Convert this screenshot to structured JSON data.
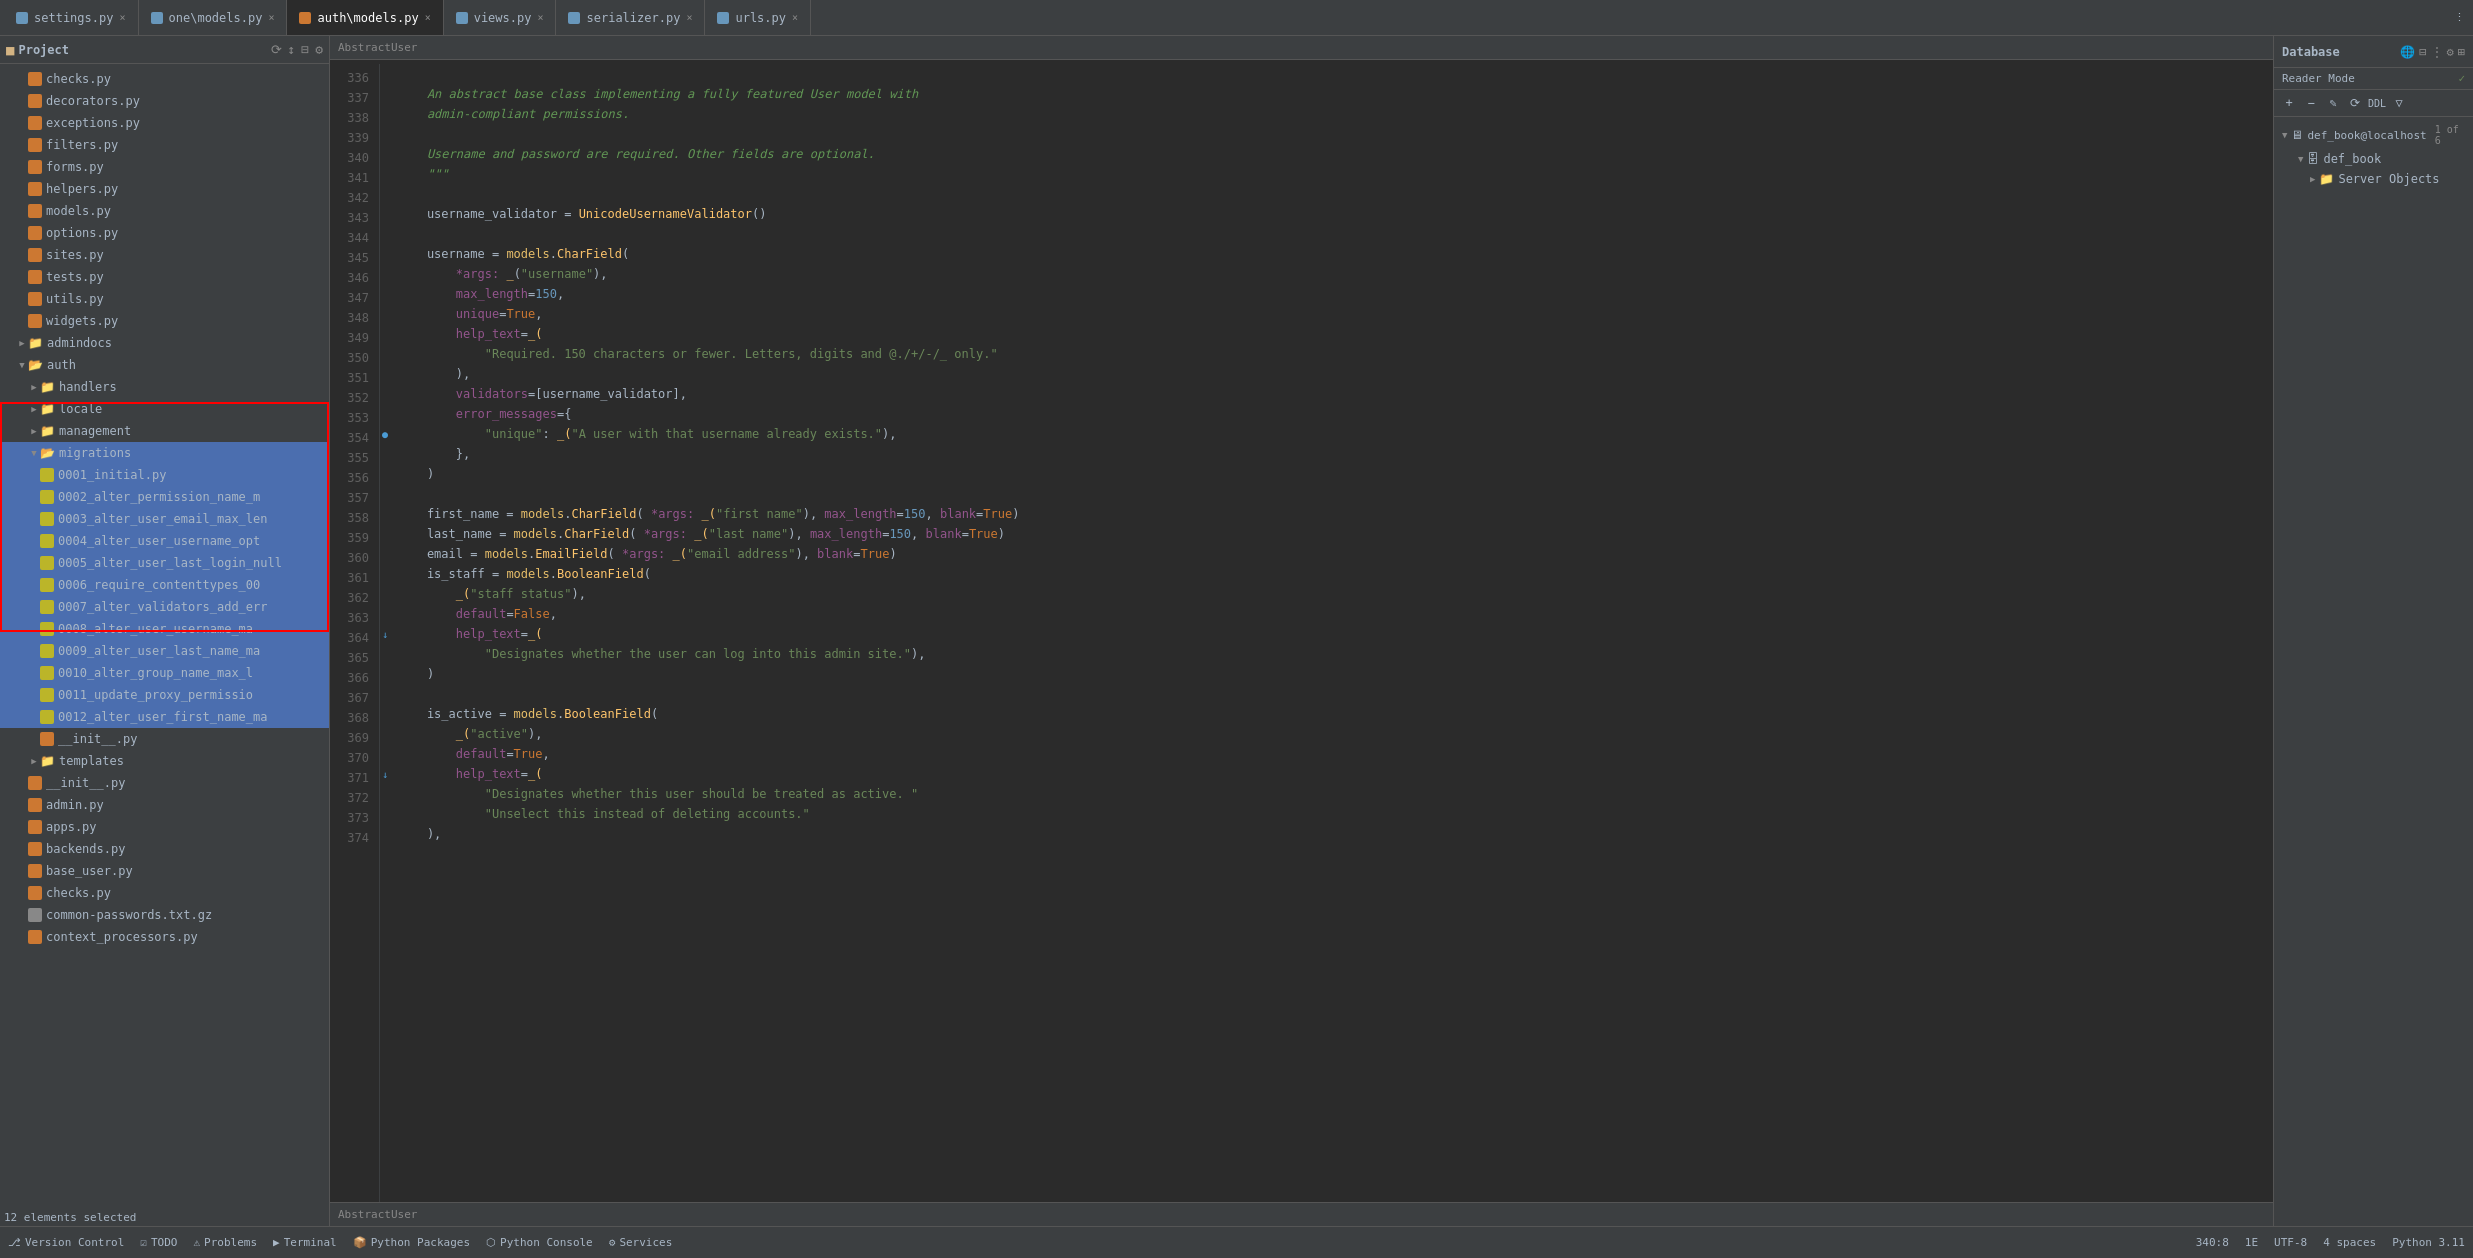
{
  "tabs": [
    {
      "label": "settings.py",
      "active": false,
      "type": "python"
    },
    {
      "label": "one\\models.py",
      "active": false,
      "type": "python"
    },
    {
      "label": "auth\\models.py",
      "active": true,
      "type": "python"
    },
    {
      "label": "views.py",
      "active": false,
      "type": "python"
    },
    {
      "label": "serializer.py",
      "active": false,
      "type": "python"
    },
    {
      "label": "urls.py",
      "active": false,
      "type": "python"
    }
  ],
  "breadcrumb": "AbstractUser",
  "database": {
    "title": "Database",
    "server": "def_book@localhost",
    "page_info": "1 of 6",
    "db_name": "def_book",
    "server_objects": "Server Objects"
  },
  "reader_mode": "Reader Mode",
  "sidebar": {
    "project_title": "Project",
    "files": [
      {
        "name": "checks.py",
        "type": "python",
        "indent": 1
      },
      {
        "name": "decorators.py",
        "type": "python",
        "indent": 1
      },
      {
        "name": "exceptions.py",
        "type": "python",
        "indent": 1
      },
      {
        "name": "filters.py",
        "type": "python",
        "indent": 1
      },
      {
        "name": "forms.py",
        "type": "python",
        "indent": 1
      },
      {
        "name": "helpers.py",
        "type": "python",
        "indent": 1
      },
      {
        "name": "models.py",
        "type": "python",
        "indent": 1
      },
      {
        "name": "options.py",
        "type": "python",
        "indent": 1
      },
      {
        "name": "sites.py",
        "type": "python",
        "indent": 1
      },
      {
        "name": "tests.py",
        "type": "python",
        "indent": 1
      },
      {
        "name": "utils.py",
        "type": "python",
        "indent": 1
      },
      {
        "name": "widgets.py",
        "type": "python",
        "indent": 1
      },
      {
        "name": "admindocs",
        "type": "folder",
        "indent": 1,
        "collapsed": true
      },
      {
        "name": "auth",
        "type": "folder",
        "indent": 1,
        "collapsed": false
      },
      {
        "name": "handlers",
        "type": "folder",
        "indent": 2,
        "collapsed": true
      },
      {
        "name": "locale",
        "type": "folder",
        "indent": 2,
        "collapsed": true
      },
      {
        "name": "management",
        "type": "folder",
        "indent": 2,
        "collapsed": true
      },
      {
        "name": "migrations",
        "type": "folder",
        "indent": 2,
        "collapsed": false,
        "selected": true
      },
      {
        "name": "0001_initial.py",
        "type": "migration",
        "indent": 3,
        "selected": true
      },
      {
        "name": "0002_alter_permission_name_m",
        "type": "migration",
        "indent": 3,
        "selected": true
      },
      {
        "name": "0003_alter_user_email_max_len",
        "type": "migration",
        "indent": 3,
        "selected": true
      },
      {
        "name": "0004_alter_user_username_opt",
        "type": "migration",
        "indent": 3,
        "selected": true
      },
      {
        "name": "0005_alter_user_last_login_null",
        "type": "migration",
        "indent": 3,
        "selected": true
      },
      {
        "name": "0006_require_contenttypes_00",
        "type": "migration",
        "indent": 3,
        "selected": true
      },
      {
        "name": "0007_alter_validators_add_err",
        "type": "migration",
        "indent": 3,
        "selected": true
      },
      {
        "name": "0008_alter_user_username_ma",
        "type": "migration",
        "indent": 3,
        "selected": true
      },
      {
        "name": "0009_alter_user_last_name_ma",
        "type": "migration",
        "indent": 3,
        "selected": true
      },
      {
        "name": "0010_alter_group_name_max_l",
        "type": "migration",
        "indent": 3,
        "selected": true
      },
      {
        "name": "0011_update_proxy_permissio",
        "type": "migration",
        "indent": 3,
        "selected": true
      },
      {
        "name": "0012_alter_user_first_name_ma",
        "type": "migration",
        "indent": 3,
        "selected": true
      },
      {
        "name": "__init__.py",
        "type": "python",
        "indent": 3
      },
      {
        "name": "templates",
        "type": "folder",
        "indent": 2,
        "collapsed": true
      },
      {
        "name": "__init__.py",
        "type": "python",
        "indent": 2
      },
      {
        "name": "admin.py",
        "type": "python",
        "indent": 2
      },
      {
        "name": "apps.py",
        "type": "python",
        "indent": 2
      },
      {
        "name": "backends.py",
        "type": "python",
        "indent": 2
      },
      {
        "name": "base_user.py",
        "type": "python",
        "indent": 2
      },
      {
        "name": "checks.py",
        "type": "python",
        "indent": 2
      },
      {
        "name": "common-passwords.txt.gz",
        "type": "text",
        "indent": 2
      },
      {
        "name": "context_processors.py",
        "type": "python",
        "indent": 2
      }
    ]
  },
  "code_lines": [
    {
      "num": 336,
      "content": ""
    },
    {
      "num": 337,
      "content": "    An abstract base class implementing a fully featured User model with"
    },
    {
      "num": 338,
      "content": "    admin-compliant permissions."
    },
    {
      "num": 339,
      "content": ""
    },
    {
      "num": 340,
      "content": "    Username and password are required. Other fields are optional."
    },
    {
      "num": 341,
      "content": "    \"\"\""
    },
    {
      "num": 342,
      "content": ""
    },
    {
      "num": 343,
      "content": "    username_validator = UnicodeUsernameValidator()"
    },
    {
      "num": 344,
      "content": ""
    },
    {
      "num": 345,
      "content": "    username = models.CharField("
    },
    {
      "num": 346,
      "content": "        *args: _(\"username\"),"
    },
    {
      "num": 347,
      "content": "        max_length=150,"
    },
    {
      "num": 348,
      "content": "        unique=True,"
    },
    {
      "num": 349,
      "content": "        help_text=_("
    },
    {
      "num": 350,
      "content": "            \"Required. 150 characters or fewer. Letters, digits and @./+/-/_ only.\""
    },
    {
      "num": 351,
      "content": "        ),"
    },
    {
      "num": 352,
      "content": "        validators=[username_validator],"
    },
    {
      "num": 353,
      "content": "        error_messages={"
    },
    {
      "num": 354,
      "content": "            \"unique\": _(\"A user with that username already exists.\"),"
    },
    {
      "num": 355,
      "content": "        },"
    },
    {
      "num": 356,
      "content": "    )"
    },
    {
      "num": 357,
      "content": ""
    },
    {
      "num": 358,
      "content": "    first_name = models.CharField( *args: _(\"first name\"), max_length=150, blank=True)"
    },
    {
      "num": 359,
      "content": "    last_name = models.CharField( *args: _(\"last name\"), max_length=150, blank=True)"
    },
    {
      "num": 360,
      "content": "    email = models.EmailField( *args: _(\"email address\"), blank=True)"
    },
    {
      "num": 361,
      "content": "    is_staff = models.BooleanField("
    },
    {
      "num": 362,
      "content": "        _(\"staff status\"),"
    },
    {
      "num": 363,
      "content": "        default=False,"
    },
    {
      "num": 364,
      "content": "        help_text=_("
    },
    {
      "num": 365,
      "content": "            \"Designates whether the user can log into this admin site.\"),"
    },
    {
      "num": 366,
      "content": "    )"
    },
    {
      "num": 367,
      "content": ""
    },
    {
      "num": 368,
      "content": "    is_active = models.BooleanField("
    },
    {
      "num": 369,
      "content": "        _(\"active\"),"
    },
    {
      "num": 370,
      "content": "        default=True,"
    },
    {
      "num": 371,
      "content": "        help_text=_("
    },
    {
      "num": 372,
      "content": "            \"Designates whether this user should be treated as active. \""
    },
    {
      "num": 373,
      "content": "            \"Unselect this instead of deleting accounts.\""
    },
    {
      "num": 374,
      "content": "    ),"
    }
  ],
  "status_bar": {
    "version_control": "Version Control",
    "todo": "TODO",
    "problems": "Problems",
    "terminal": "Terminal",
    "python_packages": "Python Packages",
    "python_console": "Python Console",
    "services": "Services"
  },
  "info_bar": {
    "position": "340:8",
    "line": "1E",
    "encoding": "UTF-8",
    "indent": "4 spaces",
    "lang": "Python 3.11"
  },
  "selection_count": "12 elements selected"
}
